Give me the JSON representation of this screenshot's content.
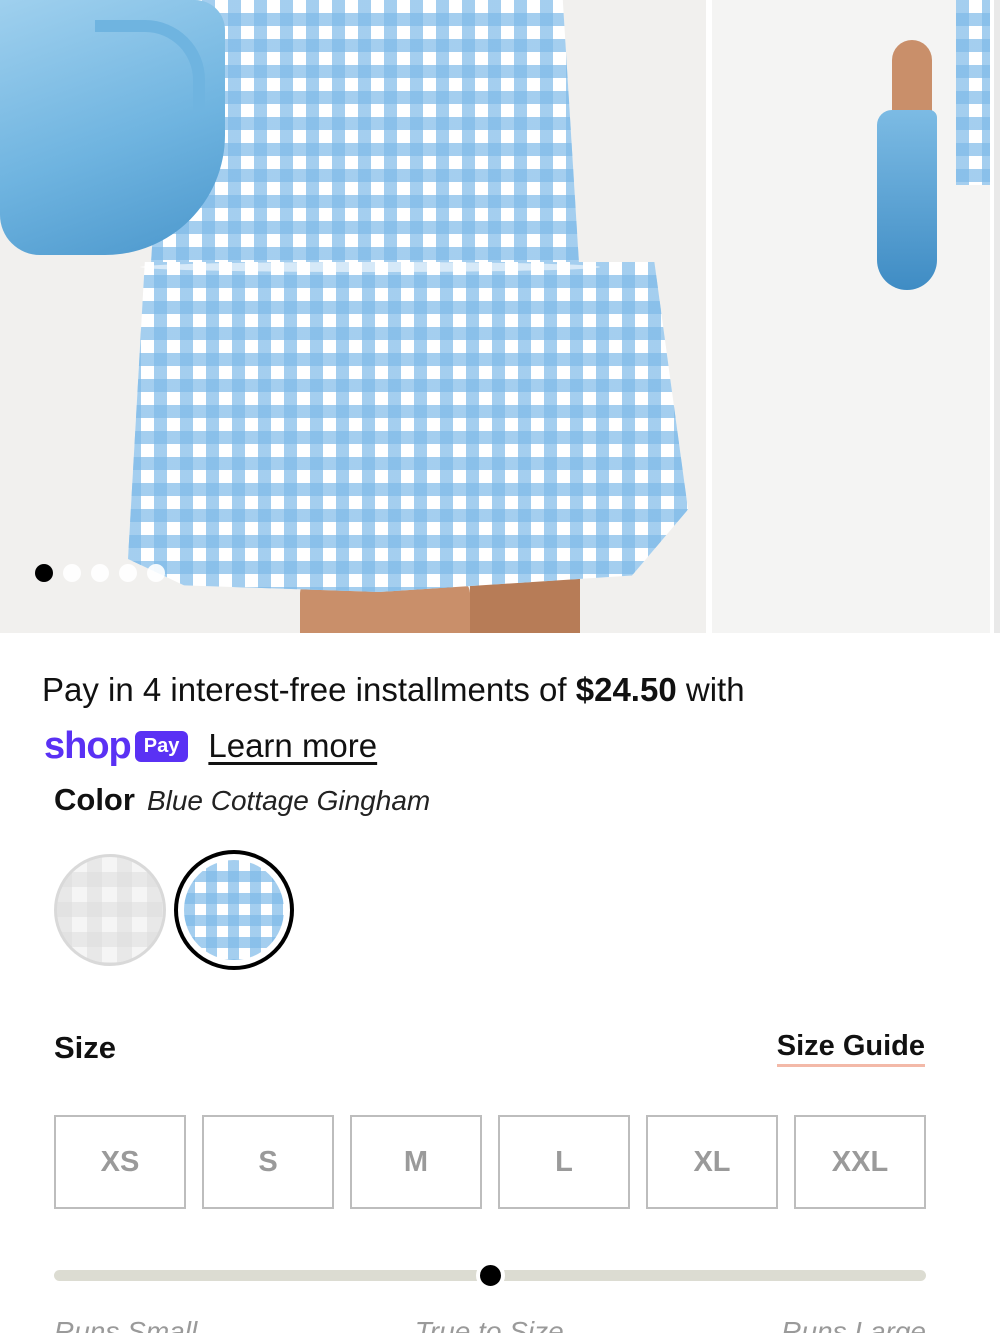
{
  "gallery": {
    "image_count": 5,
    "active_index": 0,
    "dots": [
      "dot-1",
      "dot-2",
      "dot-3",
      "dot-4",
      "dot-5"
    ]
  },
  "installments": {
    "prefix": "Pay in 4 interest-free installments of ",
    "amount": "$24.50",
    "suffix": " with"
  },
  "shop_pay": {
    "shop_word": "shop",
    "pay_badge": "Pay",
    "learn_more": "Learn more",
    "brand_color": "#5a31f4"
  },
  "color": {
    "label": "Color",
    "selected": "Blue Cottage Gingham",
    "swatches": [
      {
        "name": "White",
        "selected": false
      },
      {
        "name": "Blue Cottage Gingham",
        "selected": true
      }
    ]
  },
  "size": {
    "label": "Size",
    "guide_link": "Size Guide",
    "options": [
      "XS",
      "S",
      "M",
      "L",
      "XL",
      "XXL"
    ]
  },
  "fit": {
    "value": 0.5,
    "labels": [
      "Runs Small",
      "True to Size",
      "Runs Large"
    ]
  },
  "colors": {
    "gingham_blue": "#7ebae8",
    "guide_underline": "#f3b9a8",
    "track": "#dcdcd2"
  }
}
